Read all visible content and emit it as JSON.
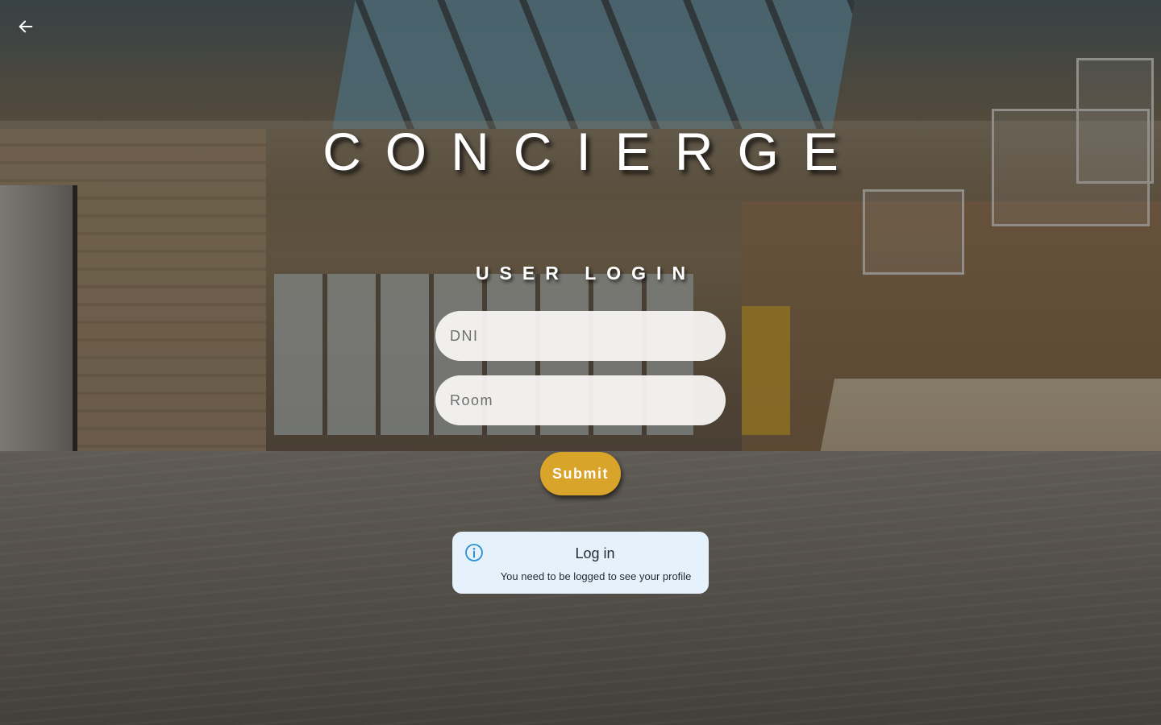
{
  "app": {
    "title": "CONCIERGE"
  },
  "header": {
    "back_icon": "arrow-left-icon"
  },
  "login": {
    "heading": "USER LOGIN",
    "dni_placeholder": "DNI",
    "dni_value": "",
    "room_placeholder": "Room",
    "room_value": "",
    "submit_label": "Submit"
  },
  "toast": {
    "icon": "info-icon",
    "title": "Log in",
    "message": "You need to be logged to see your profile"
  },
  "colors": {
    "accent": "#d8a42a",
    "toast_bg": "#e6f2fb",
    "info_icon": "#2b8fd6"
  }
}
